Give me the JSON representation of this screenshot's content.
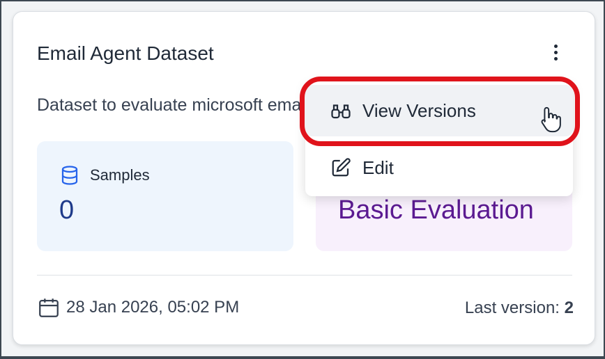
{
  "card": {
    "title": "Email Agent Dataset",
    "description": "Dataset to evaluate microsoft email agent"
  },
  "stats": {
    "samples_label": "Samples",
    "samples_value": "0",
    "eval_type": "Basic Evaluation"
  },
  "footer": {
    "created": "28 Jan 2026, 05:02 PM",
    "last_version_label": "Last version:",
    "last_version_value": "2"
  },
  "menu": {
    "view_versions": "View Versions",
    "edit": "Edit"
  },
  "colors": {
    "highlight": "#e0131b",
    "samples_bg": "#eef5fd",
    "eval_bg": "#f8f0fc",
    "eval_text": "#5b1a91",
    "samples_text": "#1e3a8a"
  },
  "icons": {
    "samples": "database-icon",
    "date": "calendar-icon",
    "view_versions": "binoculars-icon",
    "edit": "edit-icon",
    "menu": "more-vertical-icon",
    "cursor": "hand-pointer-icon"
  }
}
